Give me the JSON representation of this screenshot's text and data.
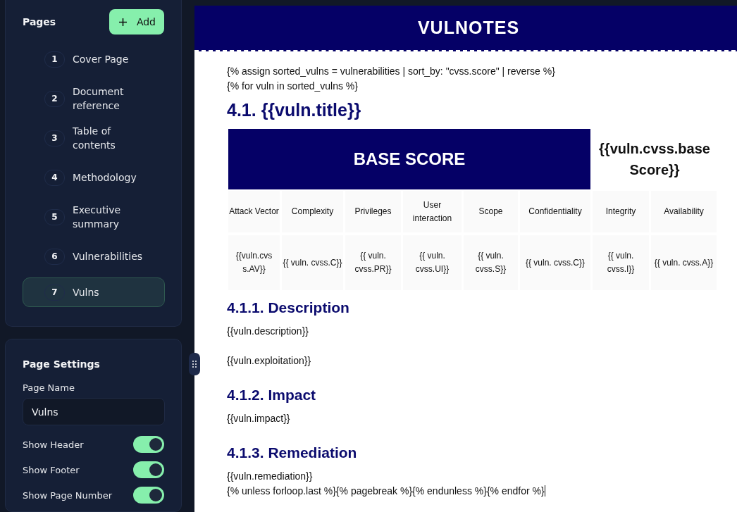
{
  "pages_panel": {
    "title": "Pages",
    "add_button": "Add",
    "pages": [
      {
        "number": "1",
        "label": "Cover Page",
        "selected": false
      },
      {
        "number": "2",
        "label": "Document reference",
        "selected": false
      },
      {
        "number": "3",
        "label": "Table of contents",
        "selected": false
      },
      {
        "number": "4",
        "label": "Methodology",
        "selected": false
      },
      {
        "number": "5",
        "label": "Executive summary",
        "selected": false
      },
      {
        "number": "6",
        "label": "Vulnerabilities",
        "selected": false
      },
      {
        "number": "7",
        "label": "Vulns",
        "selected": true
      }
    ]
  },
  "page_settings": {
    "title": "Page Settings",
    "page_name_label": "Page Name",
    "page_name_value": "Vulns",
    "toggles": [
      {
        "label": "Show Header",
        "on": true
      },
      {
        "label": "Show Footer",
        "on": true
      },
      {
        "label": "Show Page Number",
        "on": true
      }
    ]
  },
  "document": {
    "logo": "VULNOTES",
    "blocks": [
      {
        "kind": "paragraph",
        "lines": [
          "{% assign sorted_vulns = vulnerabilities | sort_by: \"cvss.score\" | reverse %}",
          "{% for vuln in sorted_vulns %}"
        ]
      },
      {
        "kind": "heading",
        "text": "4.1. {{vuln.title}}"
      },
      {
        "kind": "score_table",
        "title": "BASE SCORE",
        "score": "{{vuln.cvss.baseScore}}",
        "columns": [
          "Attack Vector",
          "Complexity",
          "Privileges",
          "User interaction",
          "Scope",
          "Confidentiality",
          "Integrity",
          "Availability"
        ],
        "values": [
          "{{vuln.cvss.AV}}",
          "{{ vuln. cvss.C}}",
          "{{ vuln. cvss.PR}}",
          "{{ vuln. cvss.UI}}",
          "{{ vuln. cvss.S}}",
          "{{ vuln. cvss.C}}",
          "{{ vuln. cvss.I}}",
          "{{ vuln. cvss.A}}"
        ]
      },
      {
        "kind": "subheading",
        "text": "4.1.1. Description"
      },
      {
        "kind": "paragraph",
        "lines": [
          "{{vuln.description}}"
        ]
      },
      {
        "kind": "paragraph",
        "lines": [
          "{{vuln.exploitation}}"
        ]
      },
      {
        "kind": "subheading",
        "text": "4.1.2. Impact"
      },
      {
        "kind": "paragraph",
        "lines": [
          "{{vuln.impact}}"
        ]
      },
      {
        "kind": "subheading",
        "text": "4.1.3. Remediation"
      },
      {
        "kind": "paragraph",
        "lines": [
          "{{vuln.remediation}}",
          "{% unless forloop.last %}{% pagebreak %}{% endunless %}{% endfor %}"
        ]
      }
    ]
  }
}
